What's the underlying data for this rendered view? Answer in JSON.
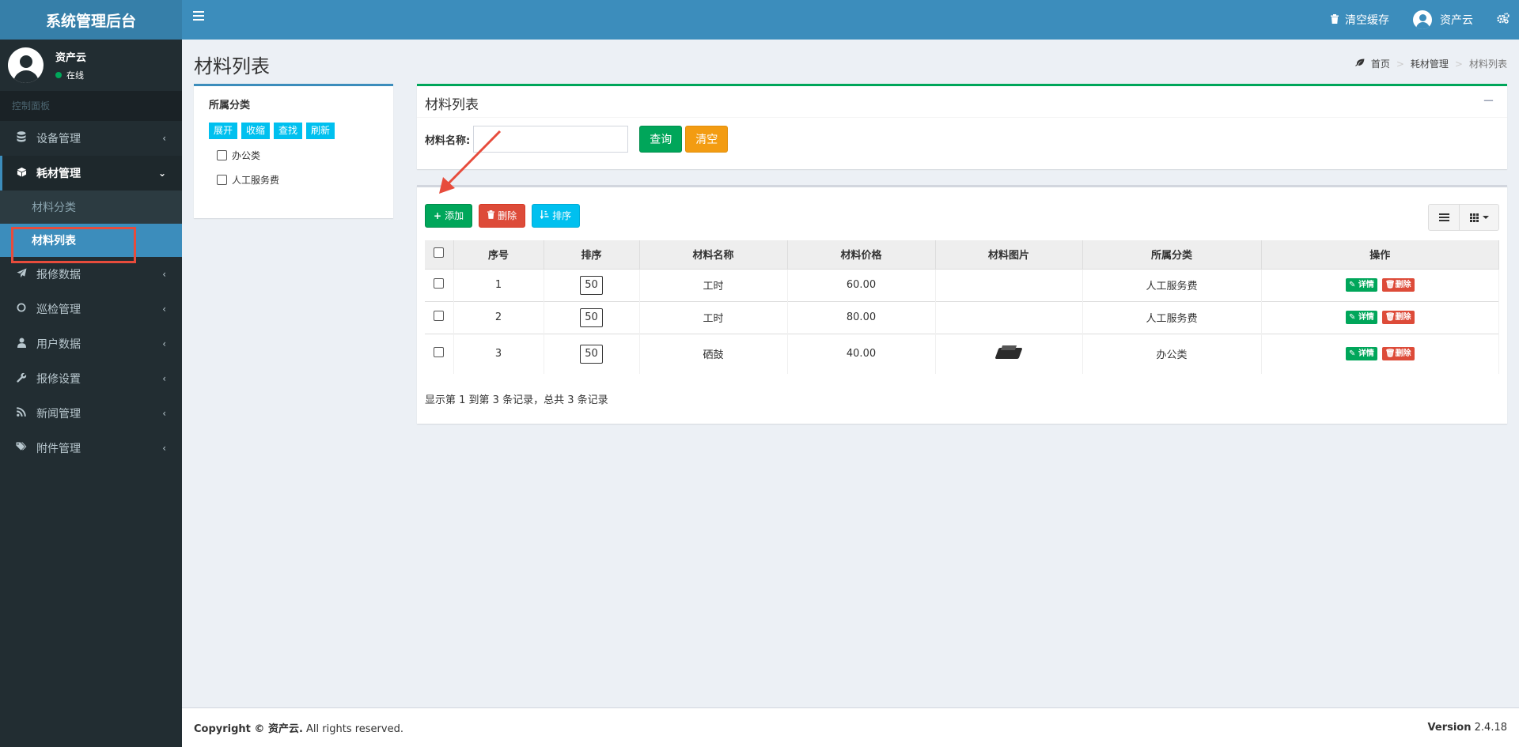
{
  "app": {
    "title": "系统管理后台"
  },
  "user": {
    "name": "资产云",
    "status": "在线"
  },
  "sidebar": {
    "section": "控制面板",
    "items": [
      {
        "label": "设备管理",
        "icon": "database-icon"
      },
      {
        "label": "耗材管理",
        "icon": "cube-icon",
        "expanded": true,
        "children": [
          {
            "label": "材料分类"
          },
          {
            "label": "材料列表",
            "active": true
          }
        ]
      },
      {
        "label": "报修数据",
        "icon": "paper-plane-icon"
      },
      {
        "label": "巡检管理",
        "icon": "circle-icon"
      },
      {
        "label": "用户数据",
        "icon": "user-icon"
      },
      {
        "label": "报修设置",
        "icon": "wrench-icon"
      },
      {
        "label": "新闻管理",
        "icon": "rss-icon"
      },
      {
        "label": "附件管理",
        "icon": "tags-icon"
      }
    ]
  },
  "header": {
    "clear_cache": "清空缓存",
    "user_name": "资产云"
  },
  "page": {
    "title": "材料列表",
    "breadcrumb": [
      "首页",
      "耗材管理",
      "材料列表"
    ]
  },
  "tree": {
    "title": "所属分类",
    "buttons": [
      "展开",
      "收缩",
      "查找",
      "刷新"
    ],
    "nodes": [
      "办公类",
      "人工服务费"
    ]
  },
  "search": {
    "title": "材料列表",
    "label": "材料名称:",
    "input_value": "",
    "query_label": "查询",
    "clear_label": "清空"
  },
  "toolbar": {
    "add_label": "添加",
    "delete_label": "删除",
    "sort_label": "排序"
  },
  "table": {
    "columns": [
      "序号",
      "排序",
      "材料名称",
      "材料价格",
      "材料图片",
      "所属分类",
      "操作"
    ],
    "rows": [
      {
        "no": "1",
        "sort": "50",
        "name": "工时",
        "price": "60.00",
        "image": "",
        "category": "人工服务费"
      },
      {
        "no": "2",
        "sort": "50",
        "name": "工时",
        "price": "80.00",
        "image": "",
        "category": "人工服务费"
      },
      {
        "no": "3",
        "sort": "50",
        "name": "硒鼓",
        "price": "40.00",
        "image": "toner-cartridge",
        "category": "办公类"
      }
    ],
    "detail_label": "详情",
    "delete_label": "删除"
  },
  "pagination": {
    "summary": "显示第 1 到第 3 条记录，总共 3 条记录"
  },
  "footer": {
    "copyright_prefix": "Copyright © 资产云.",
    "copyright_suffix": "All rights reserved.",
    "version_label": "Version",
    "version_value": "2.4.18"
  },
  "colors": {
    "header": "#3c8dbc",
    "sidebar": "#222d32",
    "success": "#00a65a",
    "danger": "#dd4b39",
    "info": "#00c0ef",
    "warning": "#f39c12",
    "annotation": "#e74c3c"
  }
}
